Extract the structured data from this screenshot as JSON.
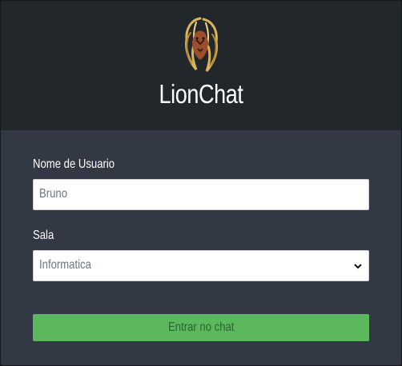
{
  "app": {
    "title": "LionChat",
    "logo_icon": "lion-head-icon"
  },
  "form": {
    "username_label": "Nome de Usuario",
    "username_value": "Bruno",
    "room_label": "Sala",
    "room_selected": "Informatica",
    "submit_label": "Entrar no chat"
  },
  "colors": {
    "header_bg": "#22272c",
    "form_bg": "#333944",
    "button_bg": "#5cb85c",
    "button_text": "#2e6330",
    "logo_gold": "#d7b25a"
  }
}
